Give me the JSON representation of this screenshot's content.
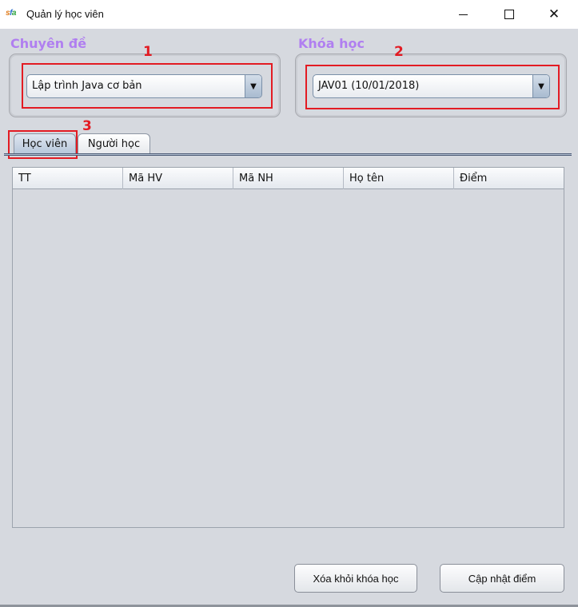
{
  "window": {
    "title": "Quản lý học viên",
    "icon_text": [
      "s",
      "f",
      "a"
    ]
  },
  "chuyen_de": {
    "label": "Chuyên đề",
    "selected": "Lập trình Java cơ bản"
  },
  "khoa_hoc": {
    "label": "Khóa học",
    "selected": "JAV01 (10/01/2018)"
  },
  "annotations": [
    "1",
    "2",
    "3"
  ],
  "tabs": [
    {
      "label": "Học viên",
      "active": true
    },
    {
      "label": "Người học",
      "active": false
    }
  ],
  "table": {
    "columns": [
      "TT",
      "Mã HV",
      "Mã NH",
      "Họ tên",
      "Điểm"
    ],
    "rows": []
  },
  "buttons": {
    "remove": "Xóa khỏi khóa học",
    "update": "Cập nhật điểm"
  },
  "colors": {
    "group_label": "#b07ff0",
    "annotation": "#e31b23"
  }
}
